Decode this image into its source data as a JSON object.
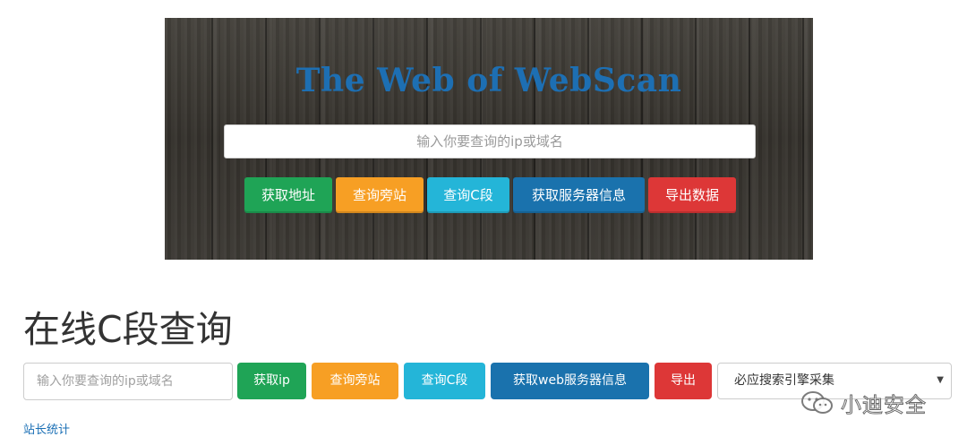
{
  "banner": {
    "title": "The Web of WebScan",
    "search_placeholder": "输入你要查询的ip或域名",
    "buttons": {
      "get_address": "获取地址",
      "query_sites": "查询旁站",
      "query_c_segment": "查询C段",
      "get_server_info": "获取服务器信息",
      "export_data": "导出数据"
    }
  },
  "section": {
    "title": "在线C段查询",
    "search_placeholder": "输入你要查询的ip或域名",
    "buttons": {
      "get_ip": "获取ip",
      "query_sites": "查询旁站",
      "query_c_segment": "查询C段",
      "get_web_server_info": "获取web服务器信息",
      "export": "导出"
    },
    "engine_select": {
      "selected": "必应搜索引擎采集"
    },
    "stats_link": "站长统计"
  },
  "watermark": {
    "text": "小迪安全",
    "icon": "wechat-logo-icon"
  },
  "colors": {
    "green": "#1fa456",
    "orange": "#f79f24",
    "cyan": "#24b5d8",
    "blue": "#1a72ad",
    "red": "#dd3737",
    "title_blue": "#1d6fb3"
  }
}
